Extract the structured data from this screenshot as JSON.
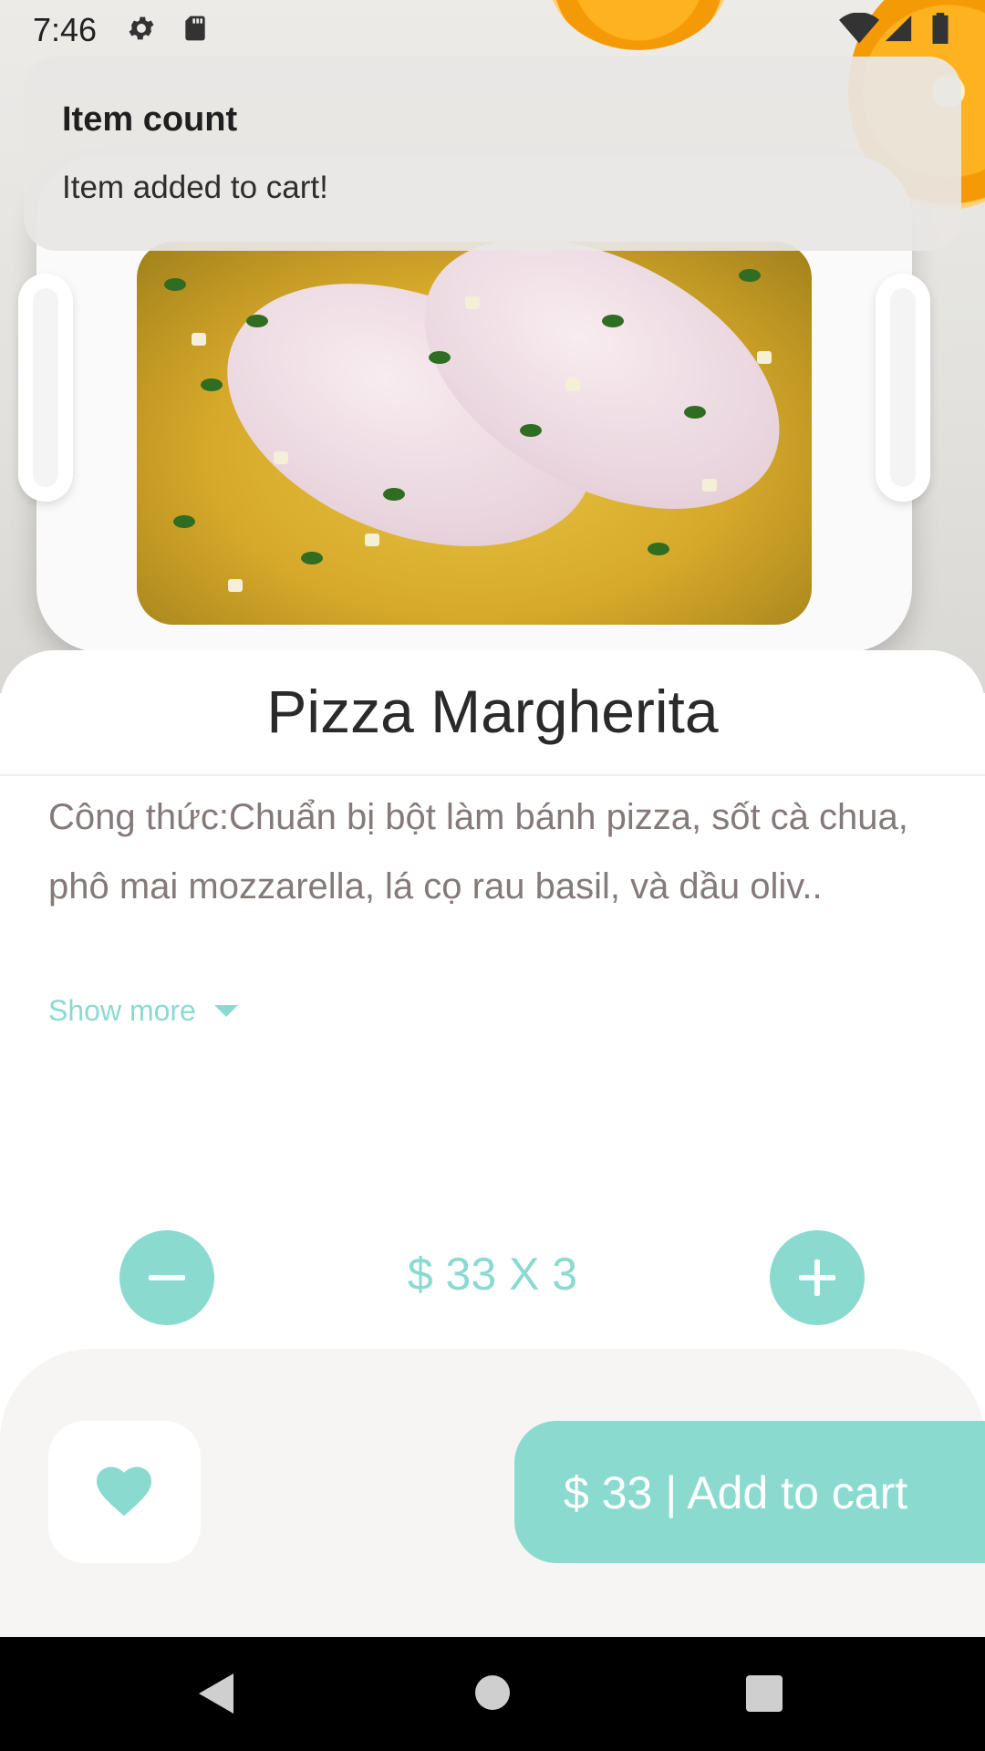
{
  "status_bar": {
    "time": "7:46",
    "icons": [
      "gear-icon",
      "sd-card-icon",
      "wifi-icon",
      "signal-icon",
      "battery-icon"
    ]
  },
  "notification": {
    "title": "Item count",
    "message": "Item added to cart!"
  },
  "product": {
    "name": "Pizza Margherita",
    "description": "Công thức:Chuẩn bị bột làm bánh pizza, sốt cà chua, phô mai mozzarella, lá cọ rau basil, và dầu oliv..",
    "show_more_label": "Show more",
    "quantity_text": "$ 33 X 3"
  },
  "actions": {
    "favorite_icon": "heart-icon",
    "add_to_cart_label": "$ 33 | Add to cart"
  },
  "navigation": {
    "buttons": [
      "back-icon",
      "home-icon",
      "recents-icon"
    ]
  },
  "colors": {
    "accent": "#8bdad0",
    "description_text": "#847a7a",
    "bottom_panel": "#f6f5f3"
  }
}
